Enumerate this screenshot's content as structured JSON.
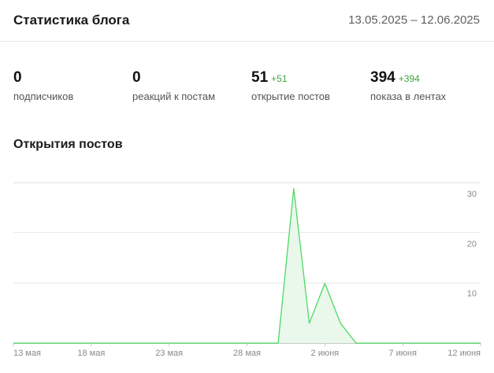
{
  "header": {
    "title": "Статистика блога",
    "date_range": "13.05.2025 – 12.06.2025"
  },
  "stats": [
    {
      "value": "0",
      "delta": "",
      "label": "подписчиков"
    },
    {
      "value": "0",
      "delta": "",
      "label": "реакций к постам"
    },
    {
      "value": "51",
      "delta": "+51",
      "label": "открытие постов"
    },
    {
      "value": "394",
      "delta": "+394",
      "label": "показа в лентах"
    }
  ],
  "chart_section": {
    "title": "Открытия постов"
  },
  "colors": {
    "line": "#4cd964",
    "fill": "#eaf8ec",
    "grid": "#e8e8e8",
    "axis": "#c9c9c9",
    "delta": "#3fa33f"
  },
  "chart_data": {
    "type": "area",
    "title": "Открытия постов",
    "x": [
      "13.05",
      "14.05",
      "15.05",
      "16.05",
      "17.05",
      "18.05",
      "19.05",
      "20.05",
      "21.05",
      "22.05",
      "23.05",
      "24.05",
      "25.05",
      "26.05",
      "27.05",
      "28.05",
      "29.05",
      "30.05",
      "31.05",
      "01.06",
      "02.06",
      "03.06",
      "04.06",
      "05.06",
      "06.06",
      "07.06",
      "08.06",
      "09.06",
      "10.06",
      "11.06",
      "12.06"
    ],
    "series": [
      {
        "values": [
          0,
          0,
          0,
          0,
          0,
          0,
          0,
          0,
          0,
          0,
          0,
          0,
          0,
          0,
          0,
          0,
          0,
          0,
          31,
          4,
          12,
          4,
          0,
          0,
          0,
          0,
          0,
          0,
          0,
          0,
          0
        ]
      }
    ],
    "x_ticks": [
      {
        "x": "13.05",
        "label": "13 мая"
      },
      {
        "x": "18.05",
        "label": "18 мая"
      },
      {
        "x": "23.05",
        "label": "23 мая"
      },
      {
        "x": "28.05",
        "label": "28 мая"
      },
      {
        "x": "02.06",
        "label": "2 июня"
      },
      {
        "x": "07.06",
        "label": "7 июня"
      },
      {
        "x": "12.06",
        "label": "12 июня"
      }
    ],
    "y_ticks": [
      10,
      20,
      30
    ],
    "ylim": [
      0,
      30
    ],
    "grid": true,
    "y_axis_position": "right",
    "legend": false
  }
}
